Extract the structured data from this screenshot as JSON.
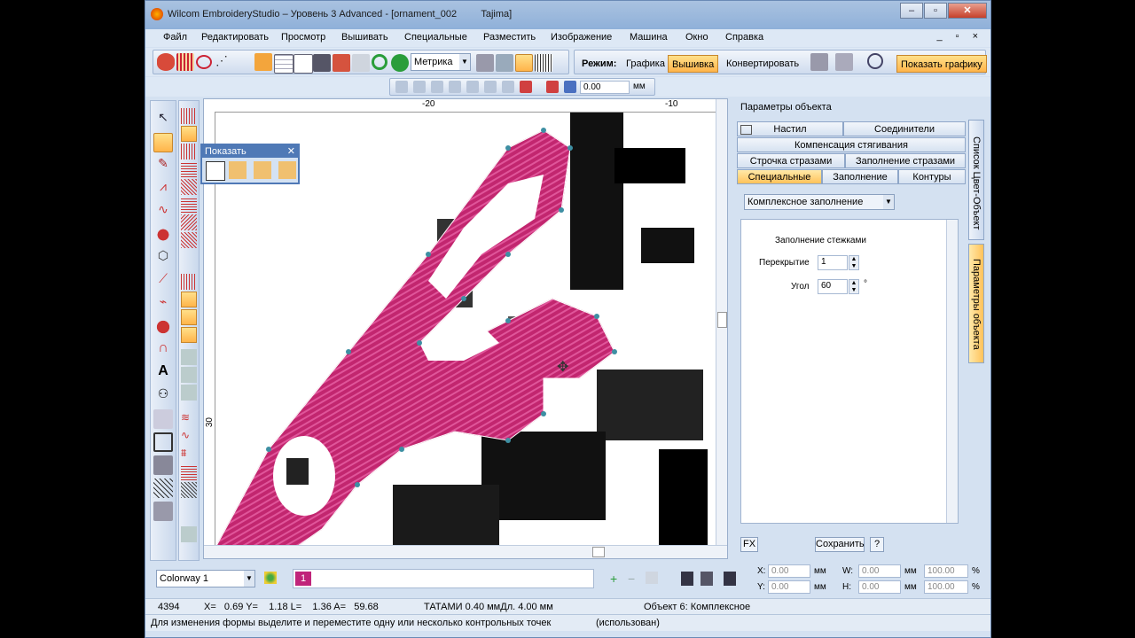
{
  "window": {
    "title": "Wilcom EmbroideryStudio – Уровень 3 Advanced - [ornament_002         Tajima]"
  },
  "window_controls": [
    "–",
    "▫",
    "✕"
  ],
  "menu": [
    "Файл",
    "Редактировать",
    "Просмотр",
    "Вышивать",
    "Специальные",
    "Разместить",
    "Изображение",
    "Машина",
    "Окно",
    "Справка"
  ],
  "mdi_controls": "_ ▫ ×",
  "toolbar": {
    "units": "Метрика",
    "mode_label": "Режим:",
    "mode_graphics": "Графика",
    "mode_embroidery": "Вышивка",
    "mode_convert": "Конвертировать",
    "show_graphics": "Показать графику",
    "spacing_value": "0.00",
    "spacing_unit": "мм"
  },
  "ruler": {
    "top_labels": [
      "-20",
      "-10"
    ],
    "left_label": "30"
  },
  "show_panel": {
    "title": "Показать",
    "close": "✕"
  },
  "object_panel": {
    "title": "Параметры объекта",
    "tabs_row1": [
      "Настил",
      "Соединители"
    ],
    "tabs_row2": [
      "Компенсация стягивания"
    ],
    "tabs_row3": [
      "Строчка стразами",
      "Заполнение стразами"
    ],
    "tabs_row4": [
      "Специальные",
      "Заполнение",
      "Контуры"
    ],
    "fill_type": "Комплексное заполнение",
    "section_title": "Заполнение стежками",
    "overlap_label": "Перекрытие",
    "overlap_value": "1",
    "angle_label": "Угол",
    "angle_value": "60",
    "angle_unit": "°",
    "fx_button": "FX",
    "save_button": "Сохранить",
    "help_button": "?"
  },
  "side_tabs": [
    "Список Цвет-Объект",
    "Параметры объекта"
  ],
  "colorway": {
    "name": "Colorway 1",
    "swatch_number": "1",
    "swatch_color": "#c0247a"
  },
  "coords": {
    "x_label": "X:",
    "y_label": "Y:",
    "w_label": "W:",
    "h_label": "H:",
    "x_value": "0.00",
    "y_value": "0.00",
    "w_value": "0.00",
    "h_value": "0.00",
    "unit": "мм",
    "scale_x": "100.00",
    "scale_y": "100.00",
    "percent": "%"
  },
  "status": {
    "stitch_count": "4394",
    "position": "X=   0.69 Y=    1.18 L=    1.36 A=   59.68",
    "stitch_info": "ТАТАМИ  0.40 ммДл.  4.00 мм",
    "object_info": "Объект 6: Комплексное",
    "hint": "Для изменения формы выделите и переместите одну или несколько контрольных точек",
    "used": "(использован)"
  },
  "colors": {
    "accent_orange": "#ffb44a",
    "thread_pink": "#d02878",
    "panel_blue": "#4f79b6"
  }
}
